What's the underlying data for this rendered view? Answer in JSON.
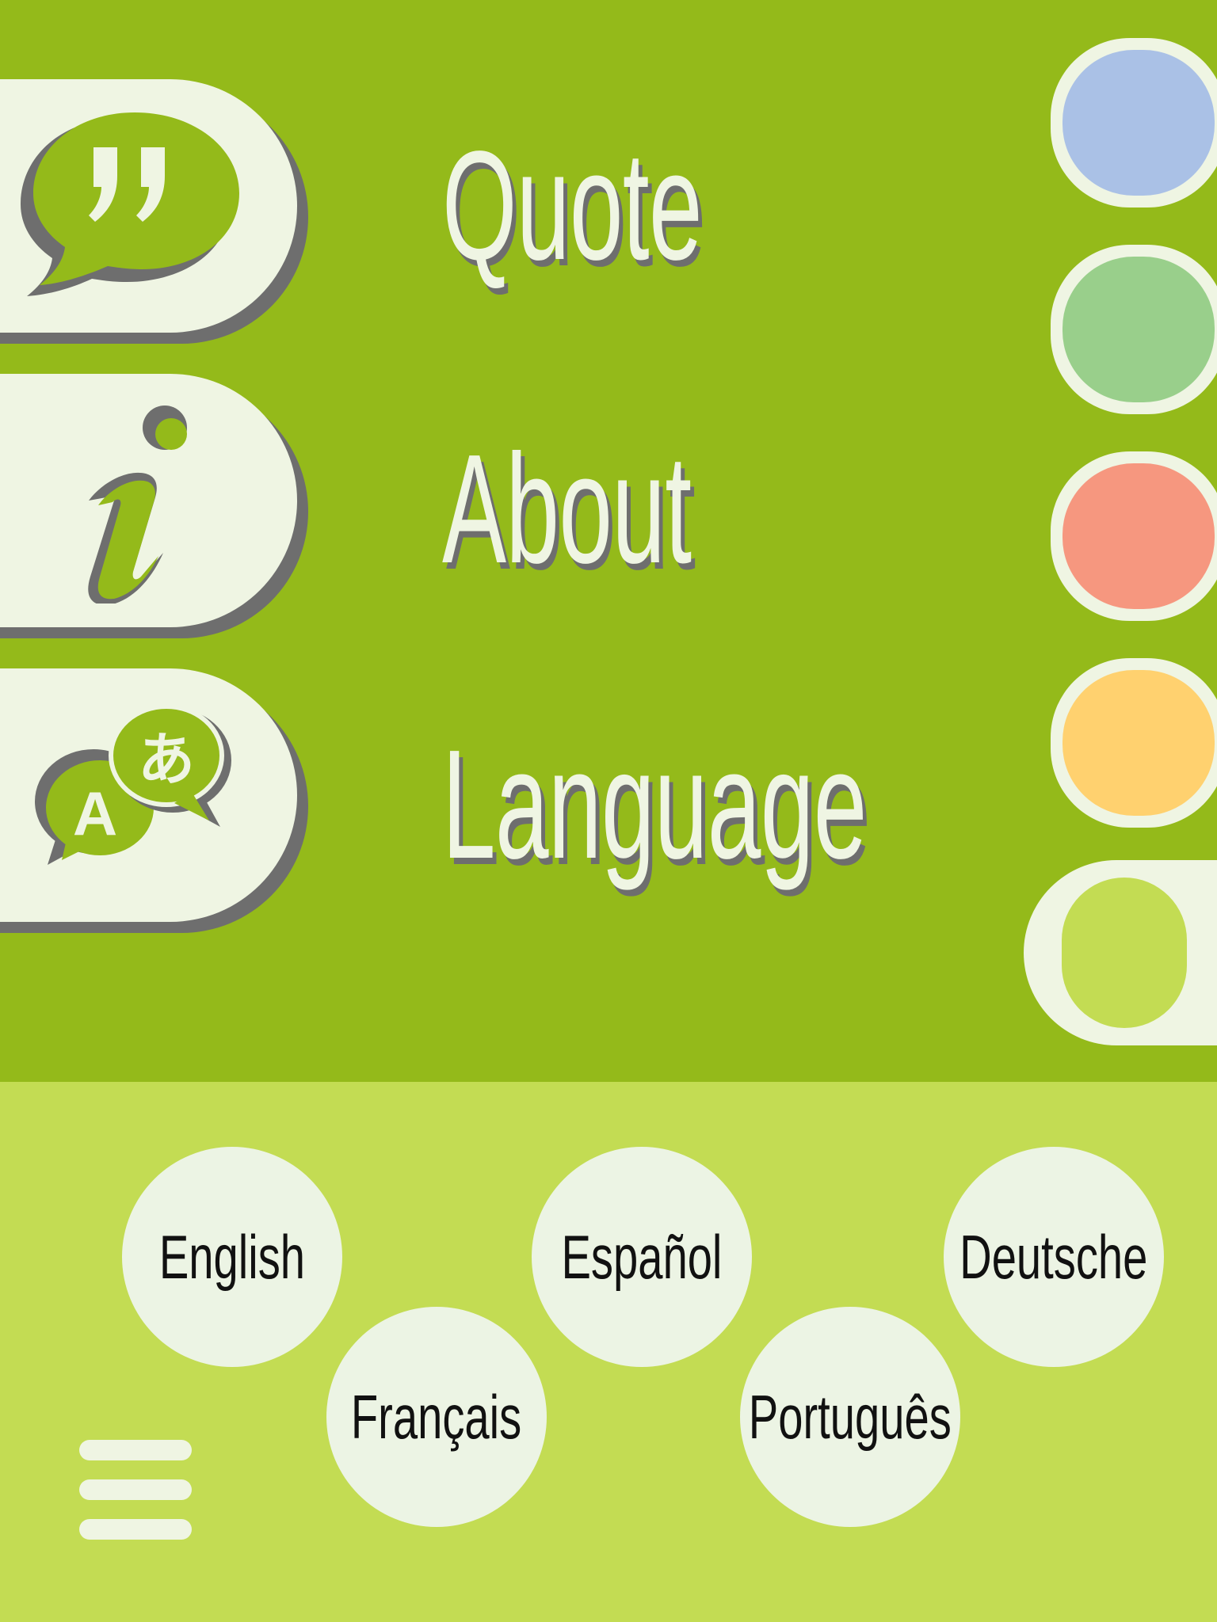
{
  "menu": {
    "items": [
      {
        "id": "quote",
        "label": "Quote",
        "icon": "quote-bubble-icon"
      },
      {
        "id": "about",
        "label": "About",
        "icon": "info-icon"
      },
      {
        "id": "language",
        "label": "Language",
        "icon": "translate-icon"
      }
    ]
  },
  "language_icon": {
    "latin_glyph": "A",
    "kana_glyph": "あ"
  },
  "themes": {
    "swatches": [
      {
        "name": "blue",
        "color": "#aac1e6"
      },
      {
        "name": "green",
        "color": "#99cf8b"
      },
      {
        "name": "red",
        "color": "#f6977f"
      },
      {
        "name": "yellow",
        "color": "#ffd16f"
      },
      {
        "name": "lime",
        "color": "#c3dc53",
        "selected": true
      }
    ]
  },
  "languages": {
    "options": [
      "English",
      "Français",
      "Español",
      "Português",
      "Deutsche"
    ]
  },
  "colors": {
    "top_background": "#94ba1a",
    "bottom_background": "#c3dc53",
    "cream": "#eff5e3",
    "shadow": "#6e6e6e"
  },
  "nav": {
    "menu_icon": "hamburger-icon"
  }
}
